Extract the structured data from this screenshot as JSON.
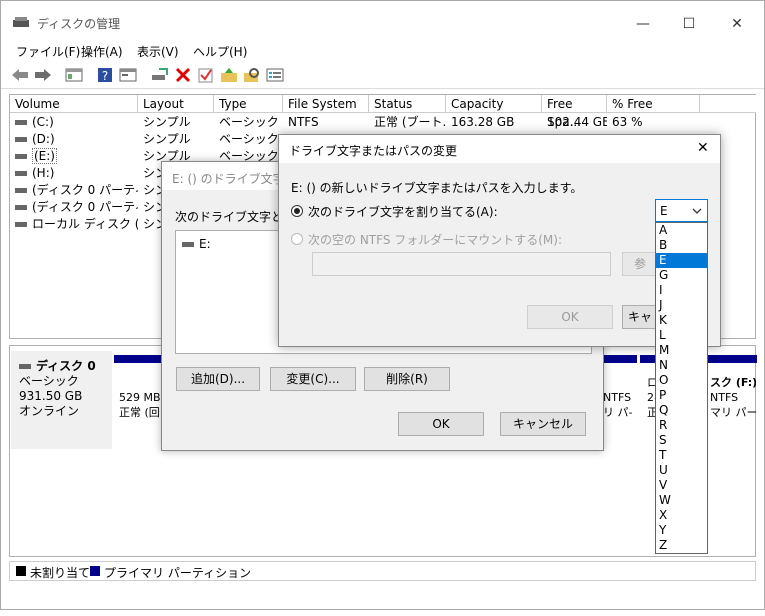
{
  "window": {
    "title": "ディスクの管理",
    "minimize": "—",
    "maximize": "☐",
    "close": "✕"
  },
  "menu": [
    "ファイル(F)",
    "操作(A)",
    "表示(V)",
    "ヘルプ(H)"
  ],
  "table": {
    "columns": [
      "Volume",
      "Layout",
      "Type",
      "File System",
      "Status",
      "Capacity",
      "Free Spa...",
      "% Free"
    ],
    "rows": [
      [
        "(C:)",
        "シンプル",
        "ベーシック",
        "NTFS",
        "正常 (ブート...",
        "163.28 GB",
        "102.44 GB",
        "63 %"
      ],
      [
        "(D:)",
        "シンプル",
        "ベーシック",
        "",
        "",
        "",
        "",
        ""
      ],
      [
        "(E:)",
        "シンプル",
        "ベーシック",
        "",
        "",
        "",
        "",
        ""
      ],
      [
        "(H:)",
        "シン",
        "",
        "",
        "",
        "",
        "",
        ""
      ],
      [
        "(ディスク 0 パーティシ...",
        "シン",
        "",
        "",
        "",
        "",
        "",
        ""
      ],
      [
        "(ディスク 0 パーティシ...",
        "シン",
        "",
        "",
        "",
        "",
        "",
        ""
      ],
      [
        "ローカル ディスク (F:)",
        "シン",
        "",
        "",
        "",
        "",
        "",
        ""
      ]
    ]
  },
  "disk": {
    "name": "ディスク 0",
    "type": "ベーシック",
    "size": "931.50 GB",
    "status": "オンライン",
    "part1_size": "529 MB",
    "part1_status": "正常 (回",
    "part2_fs": "NTFS",
    "part2_status": "リ パ-",
    "part3_l1": "ロ",
    "part3_l2": "28",
    "part3_l3": "正",
    "part4_name": "スク (F:)",
    "part4_fs": "NTFS",
    "part4_status": "マリ パーラ"
  },
  "legend": {
    "unallocated": "未割り当て",
    "primary": "プライマリ パーティション"
  },
  "dialog1": {
    "title": "E: () のドライブ文字とパ",
    "label": "次のドライブ文字とドラ",
    "list_item": "E:",
    "add": "追加(D)...",
    "change": "変更(C)...",
    "remove": "削除(R)",
    "ok": "OK",
    "cancel": "キャンセル"
  },
  "dialog2": {
    "title": "ドライブ文字またはパスの変更",
    "close": "✕",
    "description": "E: () の新しいドライブ文字またはパスを入力します。",
    "option_assign": "次のドライブ文字を割り当てる(A):",
    "option_mount": "次の空の NTFS フォルダーにマウントする(M):",
    "browse": "参",
    "ok": "OK",
    "cancel": "キャ",
    "selected_letter": "E",
    "letters": [
      "A",
      "B",
      "E",
      "G",
      "I",
      "J",
      "K",
      "L",
      "M",
      "N",
      "O",
      "P",
      "Q",
      "R",
      "S",
      "T",
      "U",
      "V",
      "W",
      "X",
      "Y",
      "Z"
    ]
  }
}
